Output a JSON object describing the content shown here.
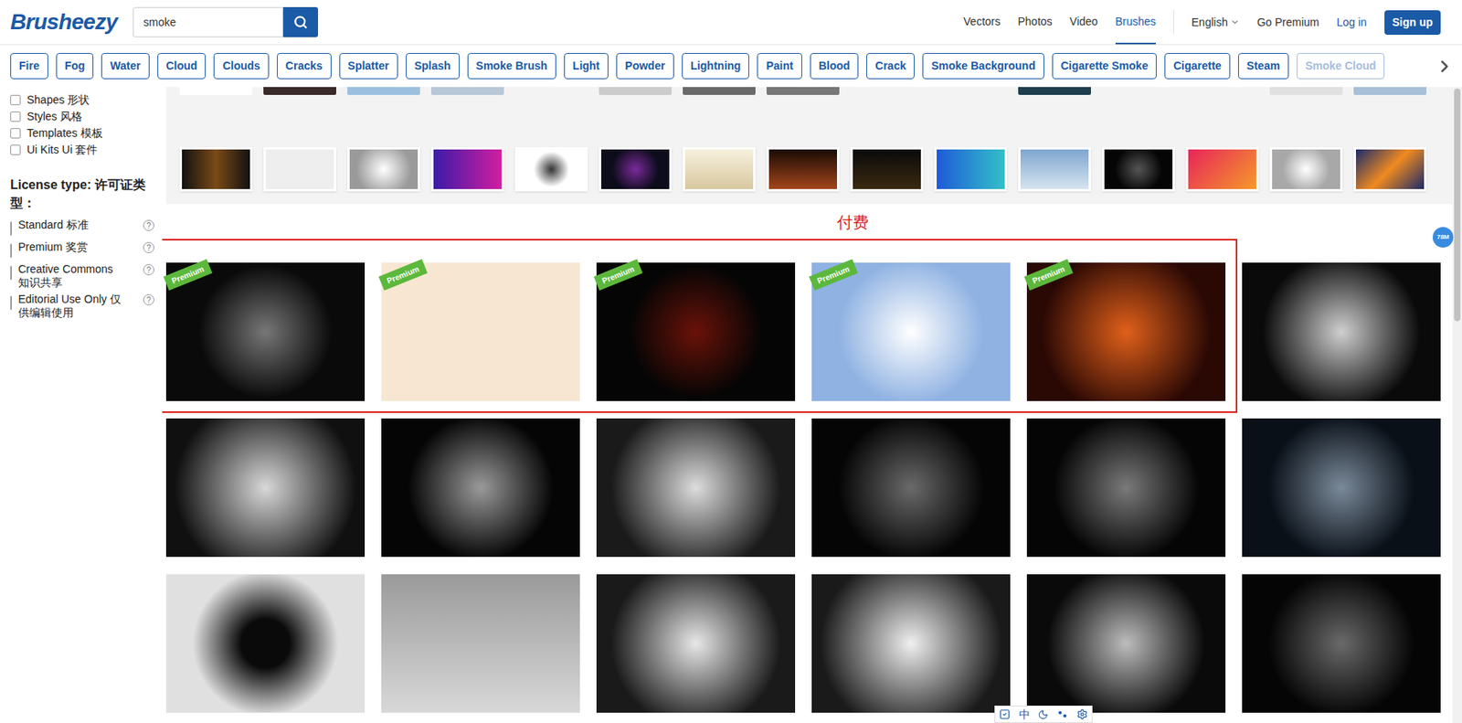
{
  "header": {
    "logo": "Brusheezy",
    "search": {
      "value": "smoke"
    },
    "nav": [
      {
        "label": "Vectors",
        "selected": false
      },
      {
        "label": "Photos",
        "selected": false
      },
      {
        "label": "Video",
        "selected": false
      },
      {
        "label": "Brushes",
        "selected": true
      }
    ],
    "language": "English",
    "go_premium": "Go Premium",
    "login": "Log in",
    "signup": "Sign up"
  },
  "tags": [
    {
      "label": "Fire",
      "faded": false
    },
    {
      "label": "Fog",
      "faded": false
    },
    {
      "label": "Water",
      "faded": false
    },
    {
      "label": "Cloud",
      "faded": false
    },
    {
      "label": "Clouds",
      "faded": false
    },
    {
      "label": "Cracks",
      "faded": false
    },
    {
      "label": "Splatter",
      "faded": false
    },
    {
      "label": "Splash",
      "faded": false
    },
    {
      "label": "Smoke Brush",
      "faded": false
    },
    {
      "label": "Light",
      "faded": false
    },
    {
      "label": "Powder",
      "faded": false
    },
    {
      "label": "Lightning",
      "faded": false
    },
    {
      "label": "Paint",
      "faded": false
    },
    {
      "label": "Blood",
      "faded": false
    },
    {
      "label": "Crack",
      "faded": false
    },
    {
      "label": "Smoke Background",
      "faded": false
    },
    {
      "label": "Cigarette Smoke",
      "faded": false
    },
    {
      "label": "Cigarette",
      "faded": false
    },
    {
      "label": "Steam",
      "faded": false
    },
    {
      "label": "Smoke Cloud",
      "faded": true
    }
  ],
  "sidebar": {
    "type_filters": [
      {
        "label": "Shapes 形状",
        "checked": false
      },
      {
        "label": "Styles 风格",
        "checked": false
      },
      {
        "label": "Templates 模板",
        "checked": false
      },
      {
        "label": "Ui Kits Ui 套件",
        "checked": false
      }
    ],
    "license": {
      "title": "License type: 许可证类型：",
      "options": [
        {
          "label": "Standard 标准",
          "checked": false,
          "help": "?"
        },
        {
          "label": "Premium 奖赏",
          "checked": false,
          "help": "?"
        },
        {
          "label": "Creative Commons 知识共享",
          "checked": false,
          "help": "?"
        },
        {
          "label": "Editorial Use Only 仅供编辑使用",
          "checked": false,
          "help": "?"
        }
      ]
    }
  },
  "annotation": {
    "label": "付费"
  },
  "premium_badge": "Premium",
  "cards": [
    {
      "premium": true
    },
    {
      "premium": true
    },
    {
      "premium": true
    },
    {
      "premium": true
    },
    {
      "premium": true
    },
    {
      "premium": false
    },
    {
      "premium": false
    },
    {
      "premium": false
    },
    {
      "premium": false
    },
    {
      "premium": false
    },
    {
      "premium": false
    },
    {
      "premium": false
    },
    {
      "premium": false
    },
    {
      "premium": false
    },
    {
      "premium": false
    },
    {
      "premium": false
    },
    {
      "premium": false
    },
    {
      "premium": false
    }
  ],
  "floating_badge": "78M",
  "ime_toolbar": {
    "mode": "中"
  }
}
